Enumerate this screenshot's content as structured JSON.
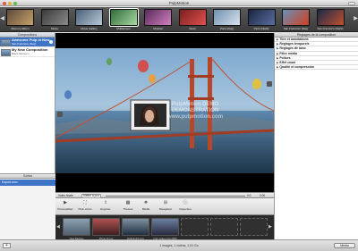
{
  "window": {
    "title": "PulpMotion"
  },
  "themes": [
    {
      "label": "Memory Album",
      "color": "#5c4a3a",
      "accent": "#c7a26a"
    },
    {
      "label": "Movie",
      "color": "#3a3a3a",
      "accent": "#8a8a8a"
    },
    {
      "label": "Movie Gallery",
      "color": "#4a6078",
      "accent": "#b8c8d8"
    },
    {
      "label": "Multiscreen",
      "color": "#2f6b3a",
      "accent": "#a8d8a0"
    },
    {
      "label": "Musical",
      "color": "#5a2a5a",
      "accent": "#d080c0"
    },
    {
      "label": "News",
      "color": "#7a2020",
      "accent": "#e05050"
    },
    {
      "label": "Paris (Day)",
      "color": "#7090b0",
      "accent": "#d8e4ee"
    },
    {
      "label": "Paris (Night)",
      "color": "#1a2440",
      "accent": "#5a70a0"
    },
    {
      "label": "San Francisco (Day)",
      "color": "#6a90b8",
      "accent": "#d04020"
    },
    {
      "label": "San Francisco (Night)",
      "color": "#1a2a48",
      "accent": "#c05030"
    }
  ],
  "left": {
    "header": "Compositions",
    "compositions": [
      {
        "title": "Awesome Pulp in New...",
        "sub": "San Francisco (Day)",
        "selected": true
      },
      {
        "title": "My New Composition",
        "sub": "Black Museum",
        "selected": false
      }
    ],
    "clips_header": "Sortes",
    "clips": [
      {
        "label": "Export.mov"
      }
    ]
  },
  "viewer": {
    "watermark_line1": "PulpMotion DEMO",
    "watermark_line2": "DEMONSTRATION",
    "watermark_line3": "www.pulpmotion.com"
  },
  "viewer_toolbar": {
    "left": "Vidéo finale",
    "mid": "Mettre à jour",
    "right_a": "0:0",
    "right_b": "0:00"
  },
  "tools": [
    {
      "label": "Prévisualiser",
      "icon": "play-icon",
      "glyph": "▶"
    },
    {
      "label": "Plein écran",
      "icon": "fullscreen-icon",
      "glyph": "⛶"
    },
    {
      "label": "Exporter",
      "icon": "export-icon",
      "glyph": "⇪"
    },
    {
      "label": "Thèmes",
      "icon": "themes-icon",
      "glyph": "▦"
    },
    {
      "label": "Média",
      "icon": "media-icon",
      "glyph": "❖"
    },
    {
      "label": "Navigateur",
      "icon": "browser-icon",
      "glyph": "⊞"
    },
    {
      "label": "Inspecteur",
      "icon": "inspector-icon",
      "glyph": "ⓘ"
    }
  ],
  "media": [
    {
      "label": "New Badges",
      "empty": false
    },
    {
      "label": "Photo 11.jpg",
      "empty": false
    },
    {
      "label": "Flight1p16.mov",
      "empty": false
    },
    {
      "label": "Intro video.mov.1080",
      "empty": false
    },
    {
      "label": "",
      "empty": true
    },
    {
      "label": "",
      "empty": true
    },
    {
      "label": "",
      "empty": true
    }
  ],
  "right": {
    "header": "Réglages de la composition",
    "sections": [
      "Titre et annotations",
      "Réglages temporels",
      "Réglages de base",
      "Filtre média",
      "Polices",
      "Effet zoom",
      "Qualité et compression"
    ]
  },
  "status": {
    "text": "1 images, 1 vidéos, 1.91 Go",
    "plus": "+",
    "media_button": "Média"
  }
}
